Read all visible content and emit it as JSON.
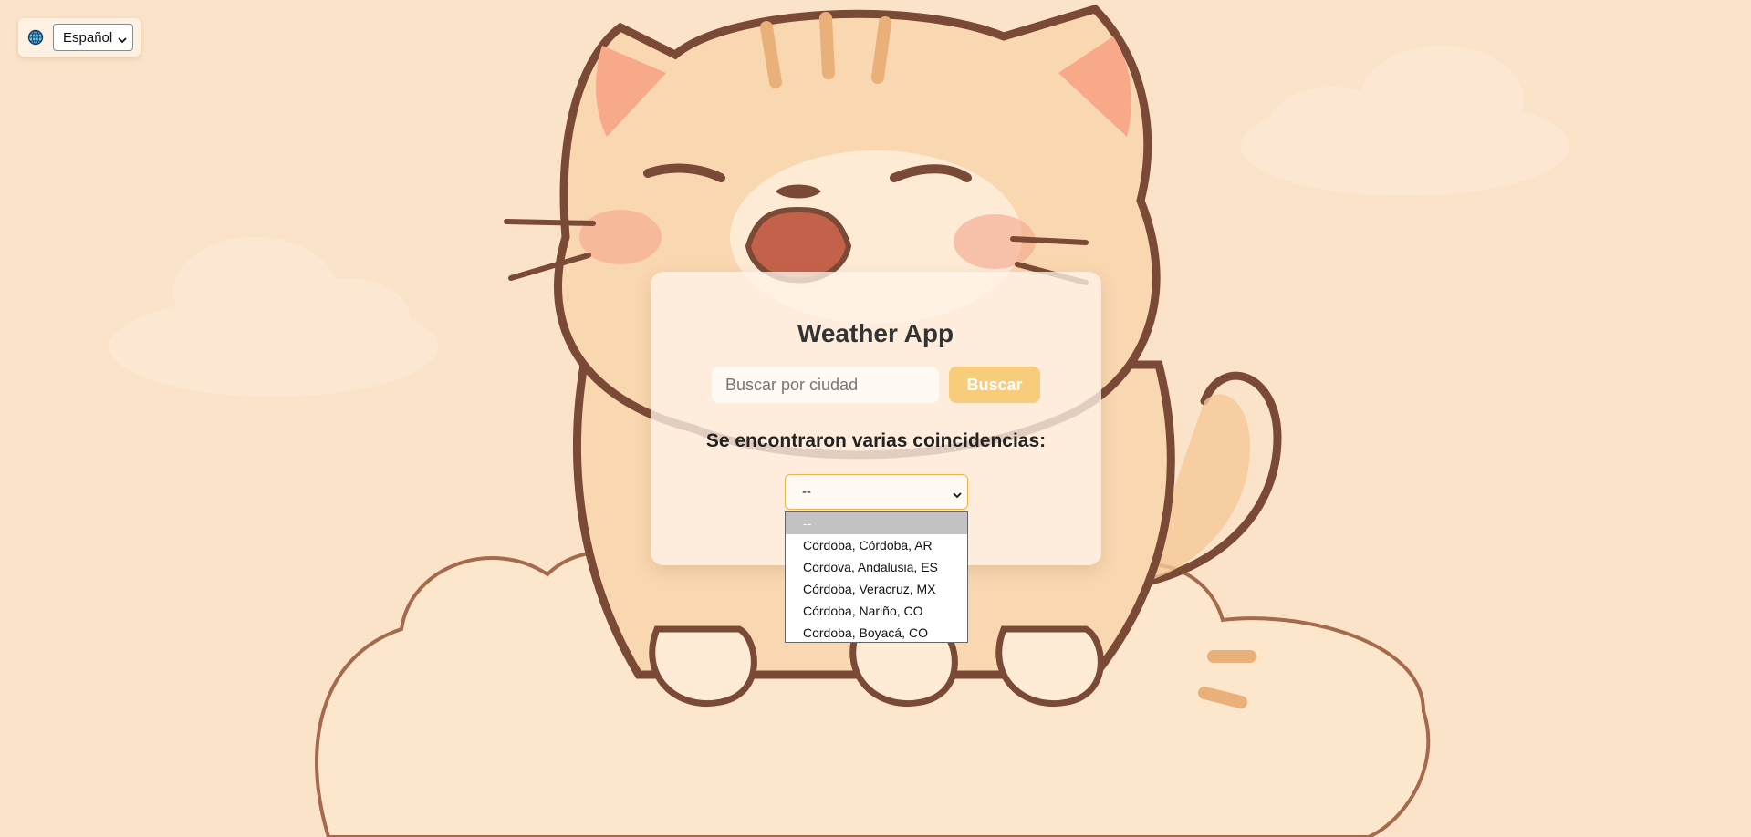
{
  "language": {
    "icon": "globe-icon",
    "selected": "Español"
  },
  "app": {
    "title": "Weather App"
  },
  "search": {
    "placeholder": "Buscar por ciudad",
    "button_label": "Buscar"
  },
  "matches": {
    "heading": "Se encontraron varias coincidencias:",
    "selected": "--",
    "options": [
      "--",
      "Cordoba, Córdoba, AR",
      "Cordova, Andalusia, ES",
      "Córdoba, Veracruz, MX",
      "Córdoba, Nariño, CO",
      "Cordoba, Boyacá, CO"
    ]
  },
  "colors": {
    "background": "#fbe3c9",
    "accent": "#f7cd7b",
    "cat_outline": "#7a4a36"
  }
}
